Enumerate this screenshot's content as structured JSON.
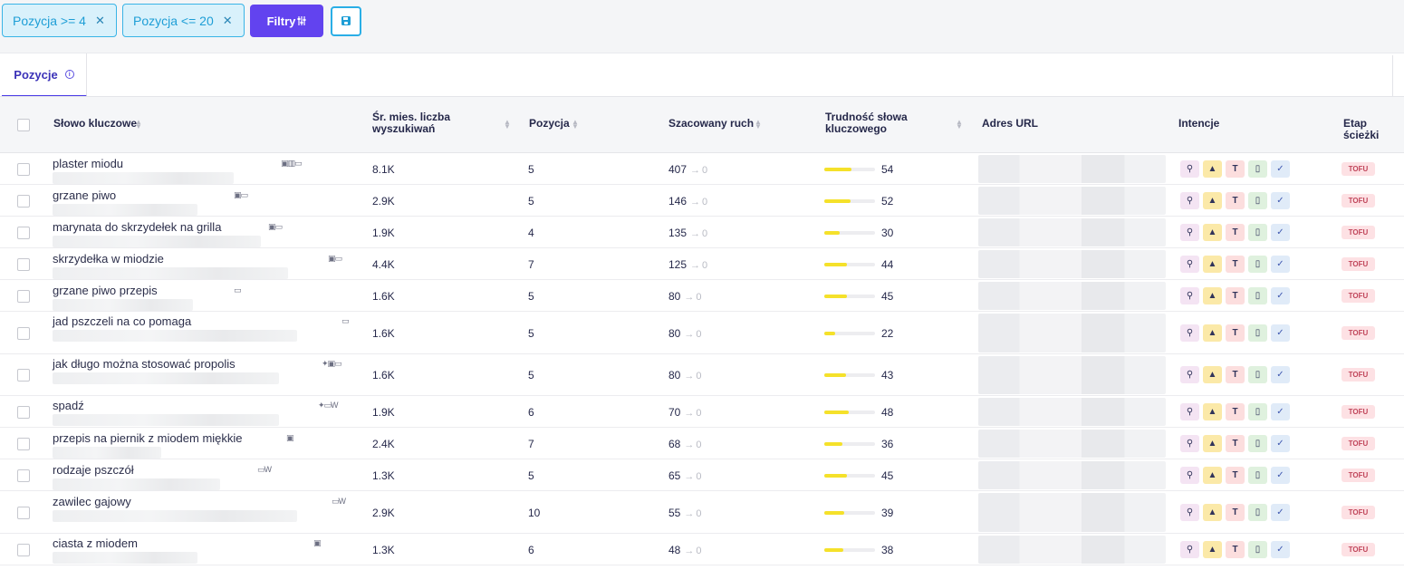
{
  "filters": {
    "chips": [
      {
        "label": "Pozycja >=  4"
      },
      {
        "label": "Pozycja <=  20"
      }
    ],
    "filters_button": "Filtry",
    "filters_icon": "sliders-icon",
    "save_icon": "save-icon"
  },
  "tabs": {
    "active": "Pozycje",
    "info_icon": "info-icon"
  },
  "table": {
    "headers": {
      "keyword": "Słowo kluczowe",
      "volume_l1": "Śr. mies. liczba",
      "volume_l2": "wyszukiwań",
      "position": "Pozycja",
      "traffic": "Szacowany ruch",
      "difficulty_l1": "Trudność słowa",
      "difficulty_l2": "kluczowego",
      "url": "Adres URL",
      "intent": "Intencje",
      "funnel": "Etap ścieżki"
    },
    "rows": [
      {
        "keyword": "plaster miodu",
        "features": "▣▥▭",
        "volume": "8.1K",
        "position": "5",
        "traffic": "407",
        "traffic_prev": "0",
        "difficulty": "54",
        "difficulty_pct": 54,
        "funnel": "TOFU"
      },
      {
        "keyword": "grzane piwo",
        "features": "▣▭",
        "volume": "2.9K",
        "position": "5",
        "traffic": "146",
        "traffic_prev": "0",
        "difficulty": "52",
        "difficulty_pct": 52,
        "funnel": "TOFU"
      },
      {
        "keyword": "marynata do skrzydełek na grilla",
        "features": "▣▭",
        "volume": "1.9K",
        "position": "4",
        "traffic": "135",
        "traffic_prev": "0",
        "difficulty": "30",
        "difficulty_pct": 30,
        "funnel": "TOFU"
      },
      {
        "keyword": "skrzydełka w miodzie",
        "features": "▣▭",
        "volume": "4.4K",
        "position": "7",
        "traffic": "125",
        "traffic_prev": "0",
        "difficulty": "44",
        "difficulty_pct": 44,
        "funnel": "TOFU"
      },
      {
        "keyword": "grzane piwo przepis",
        "features": "▭",
        "volume": "1.6K",
        "position": "5",
        "traffic": "80",
        "traffic_prev": "0",
        "difficulty": "45",
        "difficulty_pct": 45,
        "funnel": "TOFU"
      },
      {
        "keyword": "jad pszczeli na co pomaga",
        "features": "▭",
        "volume": "1.6K",
        "position": "5",
        "traffic": "80",
        "traffic_prev": "0",
        "difficulty": "22",
        "difficulty_pct": 22,
        "funnel": "TOFU"
      },
      {
        "keyword": "jak długo można stosować propolis",
        "features": "✦▣▭",
        "volume": "1.6K",
        "position": "5",
        "traffic": "80",
        "traffic_prev": "0",
        "difficulty": "43",
        "difficulty_pct": 43,
        "funnel": "TOFU"
      },
      {
        "keyword": "spadź",
        "features": "✦▭W",
        "volume": "1.9K",
        "position": "6",
        "traffic": "70",
        "traffic_prev": "0",
        "difficulty": "48",
        "difficulty_pct": 48,
        "funnel": "TOFU"
      },
      {
        "keyword": "przepis na piernik z miodem miękkie",
        "features": "▣",
        "volume": "2.4K",
        "position": "7",
        "traffic": "68",
        "traffic_prev": "0",
        "difficulty": "36",
        "difficulty_pct": 36,
        "funnel": "TOFU"
      },
      {
        "keyword": "rodzaje pszczół",
        "features": "▭W",
        "volume": "1.3K",
        "position": "5",
        "traffic": "65",
        "traffic_prev": "0",
        "difficulty": "45",
        "difficulty_pct": 45,
        "funnel": "TOFU"
      },
      {
        "keyword": "zawilec gajowy",
        "features": "▭W",
        "volume": "2.9K",
        "position": "10",
        "traffic": "55",
        "traffic_prev": "0",
        "difficulty": "39",
        "difficulty_pct": 39,
        "funnel": "TOFU"
      },
      {
        "keyword": "ciasta z miodem",
        "features": "▣",
        "volume": "1.3K",
        "position": "6",
        "traffic": "48",
        "traffic_prev": "0",
        "difficulty": "38",
        "difficulty_pct": 38,
        "funnel": "TOFU"
      }
    ],
    "intent_icons": [
      "person-search-icon",
      "tree-icon",
      "text-icon",
      "phone-icon",
      "double-check-icon"
    ],
    "colors": {
      "difficulty_bar": "#f5e12a",
      "accent": "#6243ef"
    }
  }
}
